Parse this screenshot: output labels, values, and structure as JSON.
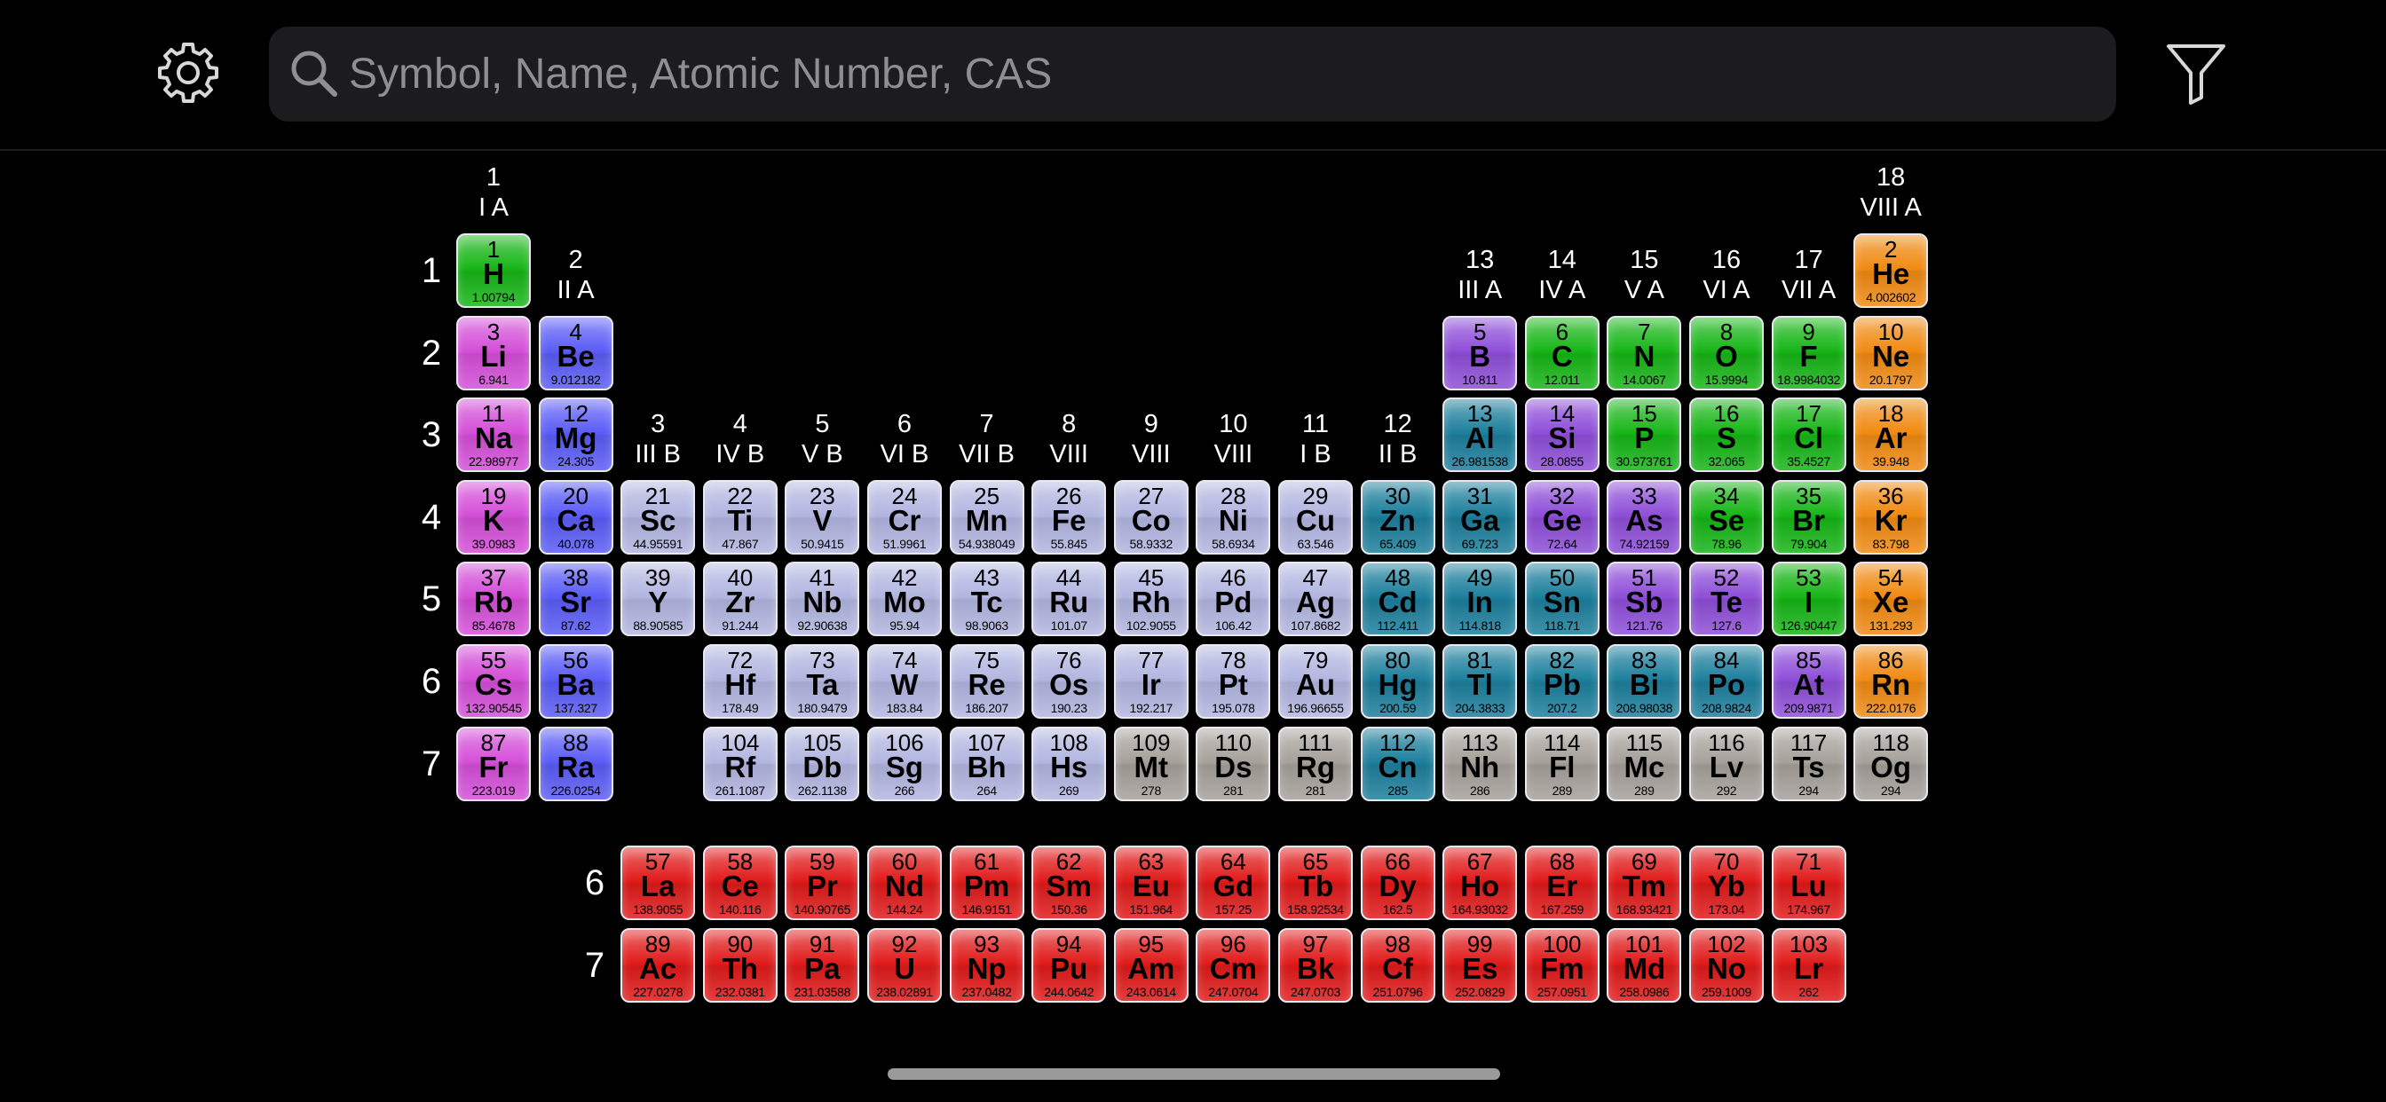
{
  "search": {
    "placeholder": "Symbol, Name, Atomic Number, CAS"
  },
  "icons": {
    "settings": "gear-icon",
    "search": "search-icon",
    "filter": "filter-icon"
  },
  "colors": {
    "alkali": "#d44ed8",
    "alkaline": "#5a5cf6",
    "transition": "#b2b6e0",
    "post_transition": "#1d7f9c",
    "metalloid": "#8e4ed8",
    "nonmetal": "#17b517",
    "noble": "#f08a12",
    "lanthanide": "#e01a1a",
    "actinide": "#e01a1a",
    "unknown": "#a6a09a"
  },
  "group_headers": [
    {
      "num": "1",
      "roman": "I A",
      "col": 1,
      "row": 1
    },
    {
      "num": "2",
      "roman": "II A",
      "col": 2,
      "row": 2
    },
    {
      "num": "3",
      "roman": "III B",
      "col": 3,
      "row": 4
    },
    {
      "num": "4",
      "roman": "IV B",
      "col": 4,
      "row": 4
    },
    {
      "num": "5",
      "roman": "V B",
      "col": 5,
      "row": 4
    },
    {
      "num": "6",
      "roman": "VI B",
      "col": 6,
      "row": 4
    },
    {
      "num": "7",
      "roman": "VII B",
      "col": 7,
      "row": 4
    },
    {
      "num": "8",
      "roman": "VIII",
      "col": 8,
      "row": 4
    },
    {
      "num": "9",
      "roman": "VIII",
      "col": 9,
      "row": 4
    },
    {
      "num": "10",
      "roman": "VIII",
      "col": 10,
      "row": 4
    },
    {
      "num": "11",
      "roman": "I B",
      "col": 11,
      "row": 4
    },
    {
      "num": "12",
      "roman": "II B",
      "col": 12,
      "row": 4
    },
    {
      "num": "13",
      "roman": "III A",
      "col": 13,
      "row": 2
    },
    {
      "num": "14",
      "roman": "IV A",
      "col": 14,
      "row": 2
    },
    {
      "num": "15",
      "roman": "V A",
      "col": 15,
      "row": 2
    },
    {
      "num": "16",
      "roman": "VI A",
      "col": 16,
      "row": 2
    },
    {
      "num": "17",
      "roman": "VII A",
      "col": 17,
      "row": 2
    },
    {
      "num": "18",
      "roman": "VIII A",
      "col": 18,
      "row": 1
    }
  ],
  "period_labels": [
    "1",
    "2",
    "3",
    "4",
    "5",
    "6",
    "7"
  ],
  "fblock_period_labels": [
    "6",
    "7"
  ],
  "elements": [
    {
      "n": "1",
      "s": "H",
      "m": "1.00794",
      "c": "nonmetal",
      "col": 1,
      "row": 1
    },
    {
      "n": "2",
      "s": "He",
      "m": "4.002602",
      "c": "noble",
      "col": 18,
      "row": 1
    },
    {
      "n": "3",
      "s": "Li",
      "m": "6.941",
      "c": "alkali",
      "col": 1,
      "row": 2
    },
    {
      "n": "4",
      "s": "Be",
      "m": "9.012182",
      "c": "alkaline",
      "col": 2,
      "row": 2
    },
    {
      "n": "5",
      "s": "B",
      "m": "10.811",
      "c": "metalloid",
      "col": 13,
      "row": 2
    },
    {
      "n": "6",
      "s": "C",
      "m": "12.011",
      "c": "nonmetal",
      "col": 14,
      "row": 2
    },
    {
      "n": "7",
      "s": "N",
      "m": "14.0067",
      "c": "nonmetal",
      "col": 15,
      "row": 2
    },
    {
      "n": "8",
      "s": "O",
      "m": "15.9994",
      "c": "nonmetal",
      "col": 16,
      "row": 2
    },
    {
      "n": "9",
      "s": "F",
      "m": "18.9984032",
      "c": "nonmetal",
      "col": 17,
      "row": 2
    },
    {
      "n": "10",
      "s": "Ne",
      "m": "20.1797",
      "c": "noble",
      "col": 18,
      "row": 2
    },
    {
      "n": "11",
      "s": "Na",
      "m": "22.98977",
      "c": "alkali",
      "col": 1,
      "row": 3
    },
    {
      "n": "12",
      "s": "Mg",
      "m": "24.305",
      "c": "alkaline",
      "col": 2,
      "row": 3
    },
    {
      "n": "13",
      "s": "Al",
      "m": "26.981538",
      "c": "post_transition",
      "col": 13,
      "row": 3
    },
    {
      "n": "14",
      "s": "Si",
      "m": "28.0855",
      "c": "metalloid",
      "col": 14,
      "row": 3
    },
    {
      "n": "15",
      "s": "P",
      "m": "30.973761",
      "c": "nonmetal",
      "col": 15,
      "row": 3
    },
    {
      "n": "16",
      "s": "S",
      "m": "32.065",
      "c": "nonmetal",
      "col": 16,
      "row": 3
    },
    {
      "n": "17",
      "s": "Cl",
      "m": "35.4527",
      "c": "nonmetal",
      "col": 17,
      "row": 3
    },
    {
      "n": "18",
      "s": "Ar",
      "m": "39.948",
      "c": "noble",
      "col": 18,
      "row": 3
    },
    {
      "n": "19",
      "s": "K",
      "m": "39.0983",
      "c": "alkali",
      "col": 1,
      "row": 4
    },
    {
      "n": "20",
      "s": "Ca",
      "m": "40.078",
      "c": "alkaline",
      "col": 2,
      "row": 4
    },
    {
      "n": "21",
      "s": "Sc",
      "m": "44.95591",
      "c": "transition",
      "col": 3,
      "row": 4
    },
    {
      "n": "22",
      "s": "Ti",
      "m": "47.867",
      "c": "transition",
      "col": 4,
      "row": 4
    },
    {
      "n": "23",
      "s": "V",
      "m": "50.9415",
      "c": "transition",
      "col": 5,
      "row": 4
    },
    {
      "n": "24",
      "s": "Cr",
      "m": "51.9961",
      "c": "transition",
      "col": 6,
      "row": 4
    },
    {
      "n": "25",
      "s": "Mn",
      "m": "54.938049",
      "c": "transition",
      "col": 7,
      "row": 4
    },
    {
      "n": "26",
      "s": "Fe",
      "m": "55.845",
      "c": "transition",
      "col": 8,
      "row": 4
    },
    {
      "n": "27",
      "s": "Co",
      "m": "58.9332",
      "c": "transition",
      "col": 9,
      "row": 4
    },
    {
      "n": "28",
      "s": "Ni",
      "m": "58.6934",
      "c": "transition",
      "col": 10,
      "row": 4
    },
    {
      "n": "29",
      "s": "Cu",
      "m": "63.546",
      "c": "transition",
      "col": 11,
      "row": 4
    },
    {
      "n": "30",
      "s": "Zn",
      "m": "65.409",
      "c": "post_transition",
      "col": 12,
      "row": 4
    },
    {
      "n": "31",
      "s": "Ga",
      "m": "69.723",
      "c": "post_transition",
      "col": 13,
      "row": 4
    },
    {
      "n": "32",
      "s": "Ge",
      "m": "72.64",
      "c": "metalloid",
      "col": 14,
      "row": 4
    },
    {
      "n": "33",
      "s": "As",
      "m": "74.92159",
      "c": "metalloid",
      "col": 15,
      "row": 4
    },
    {
      "n": "34",
      "s": "Se",
      "m": "78.96",
      "c": "nonmetal",
      "col": 16,
      "row": 4
    },
    {
      "n": "35",
      "s": "Br",
      "m": "79.904",
      "c": "nonmetal",
      "col": 17,
      "row": 4
    },
    {
      "n": "36",
      "s": "Kr",
      "m": "83.798",
      "c": "noble",
      "col": 18,
      "row": 4
    },
    {
      "n": "37",
      "s": "Rb",
      "m": "85.4678",
      "c": "alkali",
      "col": 1,
      "row": 5
    },
    {
      "n": "38",
      "s": "Sr",
      "m": "87.62",
      "c": "alkaline",
      "col": 2,
      "row": 5
    },
    {
      "n": "39",
      "s": "Y",
      "m": "88.90585",
      "c": "transition",
      "col": 3,
      "row": 5
    },
    {
      "n": "40",
      "s": "Zr",
      "m": "91.244",
      "c": "transition",
      "col": 4,
      "row": 5
    },
    {
      "n": "41",
      "s": "Nb",
      "m": "92.90638",
      "c": "transition",
      "col": 5,
      "row": 5
    },
    {
      "n": "42",
      "s": "Mo",
      "m": "95.94",
      "c": "transition",
      "col": 6,
      "row": 5
    },
    {
      "n": "43",
      "s": "Tc",
      "m": "98.9063",
      "c": "transition",
      "col": 7,
      "row": 5
    },
    {
      "n": "44",
      "s": "Ru",
      "m": "101.07",
      "c": "transition",
      "col": 8,
      "row": 5
    },
    {
      "n": "45",
      "s": "Rh",
      "m": "102.9055",
      "c": "transition",
      "col": 9,
      "row": 5
    },
    {
      "n": "46",
      "s": "Pd",
      "m": "106.42",
      "c": "transition",
      "col": 10,
      "row": 5
    },
    {
      "n": "47",
      "s": "Ag",
      "m": "107.8682",
      "c": "transition",
      "col": 11,
      "row": 5
    },
    {
      "n": "48",
      "s": "Cd",
      "m": "112.411",
      "c": "post_transition",
      "col": 12,
      "row": 5
    },
    {
      "n": "49",
      "s": "In",
      "m": "114.818",
      "c": "post_transition",
      "col": 13,
      "row": 5
    },
    {
      "n": "50",
      "s": "Sn",
      "m": "118.71",
      "c": "post_transition",
      "col": 14,
      "row": 5
    },
    {
      "n": "51",
      "s": "Sb",
      "m": "121.76",
      "c": "metalloid",
      "col": 15,
      "row": 5
    },
    {
      "n": "52",
      "s": "Te",
      "m": "127.6",
      "c": "metalloid",
      "col": 16,
      "row": 5
    },
    {
      "n": "53",
      "s": "I",
      "m": "126.90447",
      "c": "nonmetal",
      "col": 17,
      "row": 5
    },
    {
      "n": "54",
      "s": "Xe",
      "m": "131.293",
      "c": "noble",
      "col": 18,
      "row": 5
    },
    {
      "n": "55",
      "s": "Cs",
      "m": "132.90545",
      "c": "alkali",
      "col": 1,
      "row": 6
    },
    {
      "n": "56",
      "s": "Ba",
      "m": "137.327",
      "c": "alkaline",
      "col": 2,
      "row": 6
    },
    {
      "n": "72",
      "s": "Hf",
      "m": "178.49",
      "c": "transition",
      "col": 4,
      "row": 6
    },
    {
      "n": "73",
      "s": "Ta",
      "m": "180.9479",
      "c": "transition",
      "col": 5,
      "row": 6
    },
    {
      "n": "74",
      "s": "W",
      "m": "183.84",
      "c": "transition",
      "col": 6,
      "row": 6
    },
    {
      "n": "75",
      "s": "Re",
      "m": "186.207",
      "c": "transition",
      "col": 7,
      "row": 6
    },
    {
      "n": "76",
      "s": "Os",
      "m": "190.23",
      "c": "transition",
      "col": 8,
      "row": 6
    },
    {
      "n": "77",
      "s": "Ir",
      "m": "192.217",
      "c": "transition",
      "col": 9,
      "row": 6
    },
    {
      "n": "78",
      "s": "Pt",
      "m": "195.078",
      "c": "transition",
      "col": 10,
      "row": 6
    },
    {
      "n": "79",
      "s": "Au",
      "m": "196.96655",
      "c": "transition",
      "col": 11,
      "row": 6
    },
    {
      "n": "80",
      "s": "Hg",
      "m": "200.59",
      "c": "post_transition",
      "col": 12,
      "row": 6
    },
    {
      "n": "81",
      "s": "Tl",
      "m": "204.3833",
      "c": "post_transition",
      "col": 13,
      "row": 6
    },
    {
      "n": "82",
      "s": "Pb",
      "m": "207.2",
      "c": "post_transition",
      "col": 14,
      "row": 6
    },
    {
      "n": "83",
      "s": "Bi",
      "m": "208.98038",
      "c": "post_transition",
      "col": 15,
      "row": 6
    },
    {
      "n": "84",
      "s": "Po",
      "m": "208.9824",
      "c": "post_transition",
      "col": 16,
      "row": 6
    },
    {
      "n": "85",
      "s": "At",
      "m": "209.9871",
      "c": "metalloid",
      "col": 17,
      "row": 6
    },
    {
      "n": "86",
      "s": "Rn",
      "m": "222.0176",
      "c": "noble",
      "col": 18,
      "row": 6
    },
    {
      "n": "87",
      "s": "Fr",
      "m": "223.019",
      "c": "alkali",
      "col": 1,
      "row": 7
    },
    {
      "n": "88",
      "s": "Ra",
      "m": "226.0254",
      "c": "alkaline",
      "col": 2,
      "row": 7
    },
    {
      "n": "104",
      "s": "Rf",
      "m": "261.1087",
      "c": "transition",
      "col": 4,
      "row": 7
    },
    {
      "n": "105",
      "s": "Db",
      "m": "262.1138",
      "c": "transition",
      "col": 5,
      "row": 7
    },
    {
      "n": "106",
      "s": "Sg",
      "m": "266",
      "c": "transition",
      "col": 6,
      "row": 7
    },
    {
      "n": "107",
      "s": "Bh",
      "m": "264",
      "c": "transition",
      "col": 7,
      "row": 7
    },
    {
      "n": "108",
      "s": "Hs",
      "m": "269",
      "c": "transition",
      "col": 8,
      "row": 7
    },
    {
      "n": "109",
      "s": "Mt",
      "m": "278",
      "c": "unknown",
      "col": 9,
      "row": 7
    },
    {
      "n": "110",
      "s": "Ds",
      "m": "281",
      "c": "unknown",
      "col": 10,
      "row": 7
    },
    {
      "n": "111",
      "s": "Rg",
      "m": "281",
      "c": "unknown",
      "col": 11,
      "row": 7
    },
    {
      "n": "112",
      "s": "Cn",
      "m": "285",
      "c": "post_transition",
      "col": 12,
      "row": 7
    },
    {
      "n": "113",
      "s": "Nh",
      "m": "286",
      "c": "unknown",
      "col": 13,
      "row": 7
    },
    {
      "n": "114",
      "s": "Fl",
      "m": "289",
      "c": "unknown",
      "col": 14,
      "row": 7
    },
    {
      "n": "115",
      "s": "Mc",
      "m": "289",
      "c": "unknown",
      "col": 15,
      "row": 7
    },
    {
      "n": "116",
      "s": "Lv",
      "m": "292",
      "c": "unknown",
      "col": 16,
      "row": 7
    },
    {
      "n": "117",
      "s": "Ts",
      "m": "294",
      "c": "unknown",
      "col": 17,
      "row": 7
    },
    {
      "n": "118",
      "s": "Og",
      "m": "294",
      "c": "unknown",
      "col": 18,
      "row": 7
    },
    {
      "n": "57",
      "s": "La",
      "m": "138.9055",
      "c": "lanthanide",
      "col": 3,
      "row": 9
    },
    {
      "n": "58",
      "s": "Ce",
      "m": "140.116",
      "c": "lanthanide",
      "col": 4,
      "row": 9
    },
    {
      "n": "59",
      "s": "Pr",
      "m": "140.90765",
      "c": "lanthanide",
      "col": 5,
      "row": 9
    },
    {
      "n": "60",
      "s": "Nd",
      "m": "144.24",
      "c": "lanthanide",
      "col": 6,
      "row": 9
    },
    {
      "n": "61",
      "s": "Pm",
      "m": "146.9151",
      "c": "lanthanide",
      "col": 7,
      "row": 9
    },
    {
      "n": "62",
      "s": "Sm",
      "m": "150.36",
      "c": "lanthanide",
      "col": 8,
      "row": 9
    },
    {
      "n": "63",
      "s": "Eu",
      "m": "151.964",
      "c": "lanthanide",
      "col": 9,
      "row": 9
    },
    {
      "n": "64",
      "s": "Gd",
      "m": "157.25",
      "c": "lanthanide",
      "col": 10,
      "row": 9
    },
    {
      "n": "65",
      "s": "Tb",
      "m": "158.92534",
      "c": "lanthanide",
      "col": 11,
      "row": 9
    },
    {
      "n": "66",
      "s": "Dy",
      "m": "162.5",
      "c": "lanthanide",
      "col": 12,
      "row": 9
    },
    {
      "n": "67",
      "s": "Ho",
      "m": "164.93032",
      "c": "lanthanide",
      "col": 13,
      "row": 9
    },
    {
      "n": "68",
      "s": "Er",
      "m": "167.259",
      "c": "lanthanide",
      "col": 14,
      "row": 9
    },
    {
      "n": "69",
      "s": "Tm",
      "m": "168.93421",
      "c": "lanthanide",
      "col": 15,
      "row": 9
    },
    {
      "n": "70",
      "s": "Yb",
      "m": "173.04",
      "c": "lanthanide",
      "col": 16,
      "row": 9
    },
    {
      "n": "71",
      "s": "Lu",
      "m": "174.967",
      "c": "lanthanide",
      "col": 17,
      "row": 9
    },
    {
      "n": "89",
      "s": "Ac",
      "m": "227.0278",
      "c": "actinide",
      "col": 3,
      "row": 10
    },
    {
      "n": "90",
      "s": "Th",
      "m": "232.0381",
      "c": "actinide",
      "col": 4,
      "row": 10
    },
    {
      "n": "91",
      "s": "Pa",
      "m": "231.03588",
      "c": "actinide",
      "col": 5,
      "row": 10
    },
    {
      "n": "92",
      "s": "U",
      "m": "238.02891",
      "c": "actinide",
      "col": 6,
      "row": 10
    },
    {
      "n": "93",
      "s": "Np",
      "m": "237.0482",
      "c": "actinide",
      "col": 7,
      "row": 10
    },
    {
      "n": "94",
      "s": "Pu",
      "m": "244.0642",
      "c": "actinide",
      "col": 8,
      "row": 10
    },
    {
      "n": "95",
      "s": "Am",
      "m": "243.0614",
      "c": "actinide",
      "col": 9,
      "row": 10
    },
    {
      "n": "96",
      "s": "Cm",
      "m": "247.0704",
      "c": "actinide",
      "col": 10,
      "row": 10
    },
    {
      "n": "97",
      "s": "Bk",
      "m": "247.0703",
      "c": "actinide",
      "col": 11,
      "row": 10
    },
    {
      "n": "98",
      "s": "Cf",
      "m": "251.0796",
      "c": "actinide",
      "col": 12,
      "row": 10
    },
    {
      "n": "99",
      "s": "Es",
      "m": "252.0829",
      "c": "actinide",
      "col": 13,
      "row": 10
    },
    {
      "n": "100",
      "s": "Fm",
      "m": "257.0951",
      "c": "actinide",
      "col": 14,
      "row": 10
    },
    {
      "n": "101",
      "s": "Md",
      "m": "258.0986",
      "c": "actinide",
      "col": 15,
      "row": 10
    },
    {
      "n": "102",
      "s": "No",
      "m": "259.1009",
      "c": "actinide",
      "col": 16,
      "row": 10
    },
    {
      "n": "103",
      "s": "Lr",
      "m": "262",
      "c": "actinide",
      "col": 17,
      "row": 10
    }
  ]
}
